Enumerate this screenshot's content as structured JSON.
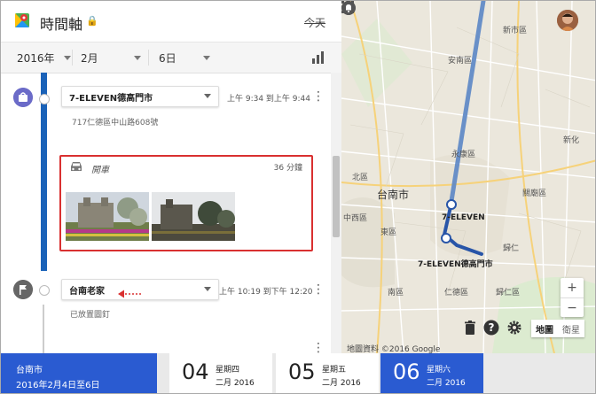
{
  "header": {
    "title": "時間軸",
    "today_label": "今天"
  },
  "date_selector": {
    "year": "2016年",
    "month": "2月",
    "day": "6日"
  },
  "timeline": {
    "entries": [
      {
        "place": "7-ELEVEN德高門市",
        "time": "上午 9:34 到上午 9:44",
        "address": "717仁德區中山路608號"
      },
      {
        "mode": "開車",
        "duration": "36 分鐘"
      },
      {
        "place": "台南老家",
        "time": "上午 10:19 到下午 12:20",
        "note": "已放置圖釘"
      }
    ]
  },
  "map": {
    "labels": {
      "city": "台南市",
      "d1": "新市區",
      "d2": "北區",
      "d3": "東區",
      "d4": "中西區",
      "d5": "南區",
      "d6": "永康區",
      "d7": "仁德區",
      "d8": "歸仁區",
      "d9": "安南區",
      "d10": "關廟區",
      "d11": "歸仁",
      "d12": "新化",
      "p1": "7-ELEVEN",
      "p2": "7-ELEVEN德高門市"
    },
    "toggle_map": "地圖",
    "toggle_satellite": "衛星",
    "attribution": "地圖資料 ©2016 Google",
    "zoom_in": "+",
    "zoom_out": "−",
    "icons": [
      "apps-icon",
      "notifications-icon",
      "trash-icon",
      "help-icon",
      "settings-icon"
    ]
  },
  "bottom": {
    "location": "台南市",
    "range": "2016年2月4日至6日",
    "days": [
      {
        "num": "04",
        "weekday": "星期四",
        "month_year": "二月 2016"
      },
      {
        "num": "05",
        "weekday": "星期五",
        "month_year": "二月 2016"
      },
      {
        "num": "06",
        "weekday": "星期六",
        "month_year": "二月 2016"
      }
    ],
    "active_day_index": 2
  },
  "colors": {
    "accent": "#2a5bd1",
    "timeline": "#1a62b8",
    "highlight": "#d93030"
  }
}
